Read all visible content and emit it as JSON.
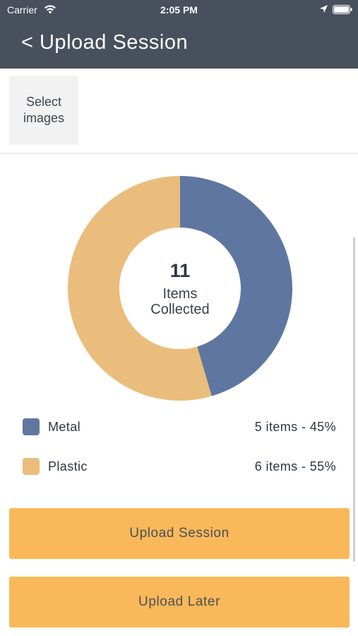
{
  "status_bar": {
    "carrier": "Carrier",
    "time": "2:05 PM",
    "icons": [
      "wifi-icon",
      "location-arrow-icon",
      "battery-icon"
    ]
  },
  "header": {
    "title": "< Upload Session"
  },
  "toolbar": {
    "select_images_label": "Select\nimages"
  },
  "summary": {
    "count": "11",
    "count_label": "Items\nCollected"
  },
  "chart_data": {
    "type": "pie",
    "categories": [
      "Metal",
      "Plastic"
    ],
    "values": [
      5,
      6
    ],
    "colors": [
      "#5f77a0",
      "#eabd7d"
    ]
  },
  "legend": [
    {
      "label": "Metal",
      "detail": "5 items - 45%",
      "color": "#5f77a0"
    },
    {
      "label": "Plastic",
      "detail": "6 items - 55%",
      "color": "#eabd7d"
    }
  ],
  "actions": {
    "upload_session_label": "Upload Session",
    "upload_later_label": "Upload Later"
  },
  "colors": {
    "header_bg": "#47505c",
    "button_bg": "#f9b95a"
  }
}
